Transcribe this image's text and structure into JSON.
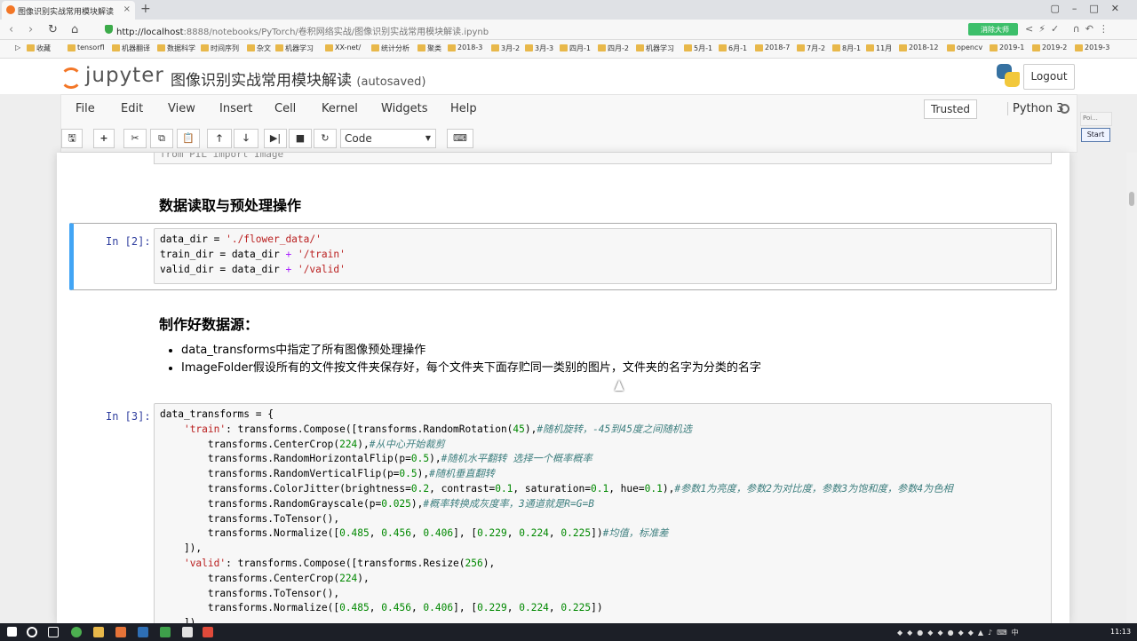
{
  "browser": {
    "tab_title": "图像识别实战常用模块解读",
    "url_host": "http://localhost",
    "url_path": ":8888/notebooks/PyTorch/卷积网络实战/图像识别实战常用模块解读.ipynb",
    "ext_label": "消除大师"
  },
  "bookmarks": [
    "收藏",
    "tensorfl",
    "机器翻译",
    "数据科学",
    "时间序列",
    "杂文",
    "机器学习",
    "XX-net/",
    "统计分析",
    "聚类",
    "2018-3",
    "3月-2",
    "3月-3",
    "四月-1",
    "四月-2",
    "机器学习",
    "5月-1",
    "6月-1",
    "2018-7",
    "7月-2",
    "8月-1",
    "11月",
    "2018-12",
    "opencv",
    "2019-1",
    "2019-2",
    "2019-3"
  ],
  "header": {
    "logo_text": "jupyter",
    "notebook_title": "图像识别实战常用模块解读",
    "autosave": "(autosaved)",
    "logout_label": "Logout"
  },
  "menu": {
    "items": [
      "File",
      "Edit",
      "View",
      "Insert",
      "Cell",
      "Kernel",
      "Widgets",
      "Help"
    ],
    "trusted": "Trusted",
    "kernel_name": "Python 3"
  },
  "toolbar": {
    "cell_type": "Code"
  },
  "widget": {
    "label": "Poi...",
    "start": "Start"
  },
  "notebook": {
    "prev_code": "from PIL import Image",
    "heading1": "数据读取与预处理操作",
    "cell2_prompt": "In [2]:",
    "heading2": "制作好数据源：",
    "bullets": [
      "data_transforms中指定了所有图像预处理操作",
      "ImageFolder假设所有的文件按文件夹保存好，每个文件夹下面存贮同一类别的图片，文件夹的名字为分类的名字"
    ],
    "cell3_prompt": "In [3]:"
  },
  "taskbar": {
    "clock": "11:13"
  }
}
